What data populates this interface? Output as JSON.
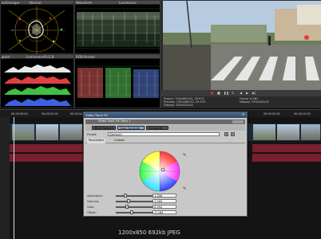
{
  "app": {
    "watermark": "1200x850 692kb JPEG"
  },
  "scopes": {
    "vectorscope_label": "ectorscope",
    "vectorscope_mode": "Normal",
    "waveform_label": "Waveform",
    "waveform_mode": "Luminance",
    "histogram_label": "gram",
    "histogram_mode": "Luminance/R,G,B",
    "parade_label": "RGB Parade"
  },
  "preview": {
    "info_left": [
      "Project: 720x480x32, 29.970",
      "Preview: 720x480x32, 29.970",
      "Display: 333x222x32"
    ],
    "info_right": [
      "Frame: 6,361",
      "Display: 333x222x32"
    ]
  },
  "timeline": {
    "timecodes": [
      "00:00:00:00",
      "00:00:02:00",
      "00:00:04:00",
      "00:00:05:00",
      "00:00:10:00"
    ]
  },
  "dialog": {
    "title": "Video Track FX",
    "chain_label": "Video Track FX:",
    "chain_target": "Track 1",
    "plugins": [
      "White Balance",
      "Color Corrector",
      "Composite"
    ],
    "preset_label": "Preset:",
    "preset_value": "(Default)",
    "tabs": [
      "Parameters",
      "Custom"
    ],
    "params": [
      {
        "label": "Saturation:",
        "value": "1.306",
        "level": 0.2
      },
      {
        "label": "Gamma:",
        "value": "1.000",
        "level": 0.3
      },
      {
        "label": "Gain:",
        "value": "0.952",
        "level": 0.25
      },
      {
        "label": "Offset:",
        "value": "-0.184",
        "level": 0.4
      }
    ]
  },
  "colors": {
    "accent": "#3a6fb0",
    "audio": "#7a1f2c",
    "dialog_bg": "#c8c8c8"
  }
}
